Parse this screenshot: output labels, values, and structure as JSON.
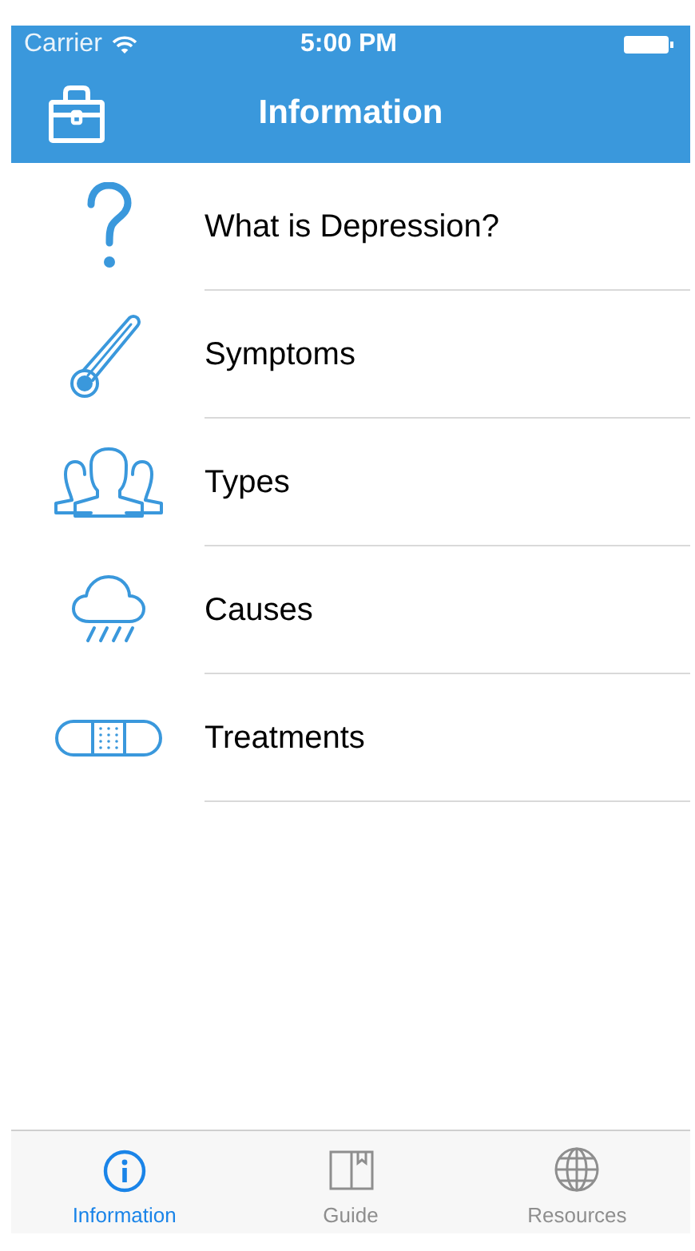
{
  "status_bar": {
    "carrier": "Carrier",
    "time": "5:00 PM"
  },
  "nav_bar": {
    "title": "Information"
  },
  "items": [
    {
      "label": "What is Depression?"
    },
    {
      "label": "Symptoms"
    },
    {
      "label": "Types"
    },
    {
      "label": "Causes"
    },
    {
      "label": "Treatments"
    }
  ],
  "tabs": [
    {
      "label": "Information",
      "selected": true
    },
    {
      "label": "Guide",
      "selected": false
    },
    {
      "label": "Resources",
      "selected": false
    }
  ]
}
